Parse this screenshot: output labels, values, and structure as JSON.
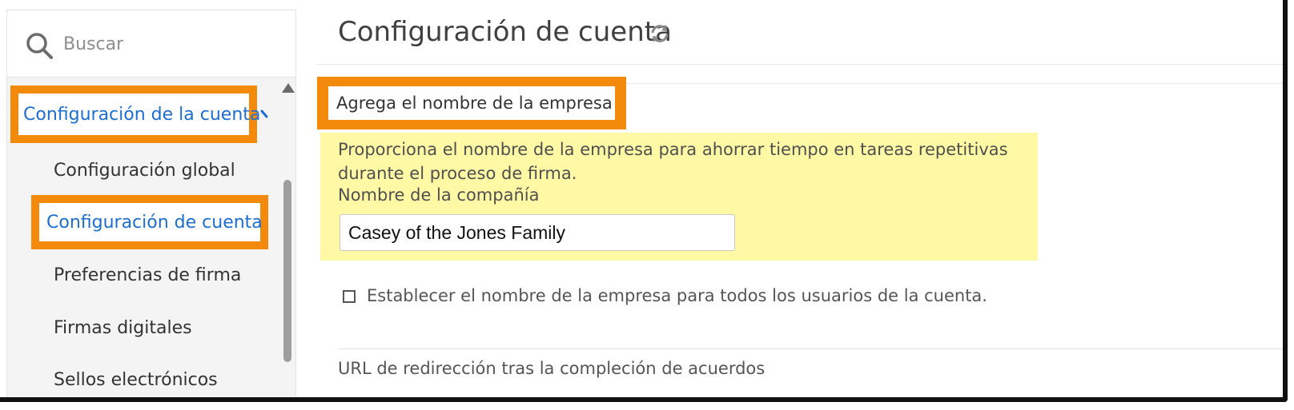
{
  "sidebar": {
    "search_placeholder": "Buscar",
    "section_label": "Configuración de la cuenta",
    "items": [
      {
        "label": "Configuración global"
      },
      {
        "label": "Configuración de cuenta"
      },
      {
        "label": "Preferencias de firma"
      },
      {
        "label": "Firmas digitales"
      },
      {
        "label": "Sellos electrónicos"
      }
    ]
  },
  "main": {
    "title": "Configuración de cuenta",
    "section": {
      "label": "Agrega el nombre de la empresa",
      "description": "Proporciona el nombre de la empresa para ahorrar tiempo en tareas repetitivas durante el proceso de firma.",
      "field_label": "Nombre de la compañía",
      "field_value": "Casey of the Jones Family"
    },
    "checkbox_label": "Establecer el nombre de la empresa para todos los usuarios de la cuenta.",
    "redirect_label": "URL de redirección tras la compleción de acuerdos"
  },
  "colors": {
    "highlight_orange": "#f48a0c",
    "highlight_yellow": "#fff8a4",
    "link_blue": "#1c6fd1"
  },
  "icons": [
    "search-icon",
    "chevron-up-icon",
    "refresh-icon",
    "scroll-up-arrow-icon"
  ]
}
